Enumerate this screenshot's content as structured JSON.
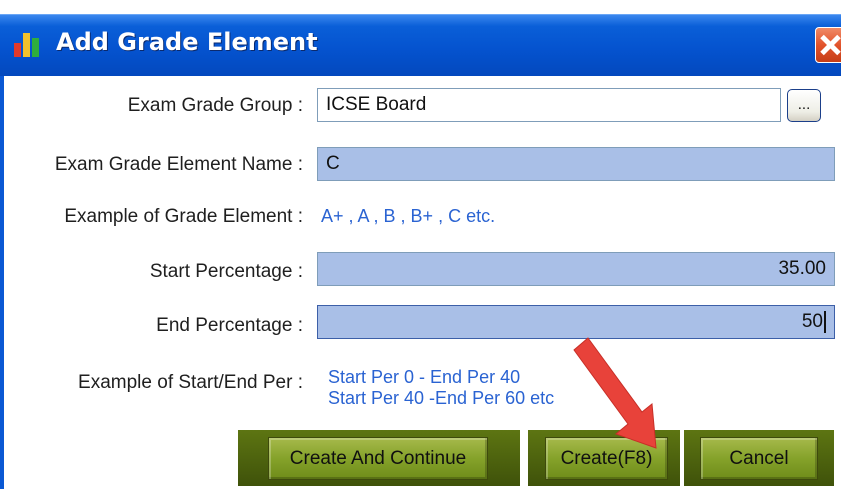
{
  "window": {
    "title": "Add Grade Element"
  },
  "form": {
    "exam_grade_group": {
      "label": "Exam Grade Group :",
      "value": "ICSE Board",
      "browse_label": "..."
    },
    "element_name": {
      "label": "Exam Grade Element Name :",
      "value": "C"
    },
    "grade_example": {
      "label": "Example of Grade Element :",
      "text": "A+ , A , B , B+ , C etc."
    },
    "start_percentage": {
      "label": "Start Percentage :",
      "value": "35.00"
    },
    "end_percentage": {
      "label": "End Percentage :",
      "value": "50"
    },
    "range_example": {
      "label": "Example of Start/End Per :",
      "line1": "Start Per 0 - End Per 40",
      "line2": "Start Per 40 -End Per  60  etc"
    }
  },
  "buttons": {
    "create_continue": "Create And Continue",
    "create": "Create(F8)",
    "cancel": "Cancel"
  },
  "colors": {
    "titlebar": "#0553cf",
    "field_highlight": "#a9bfe7",
    "example_text": "#2a63d2",
    "button_green": "#85a22a",
    "annotation_arrow": "#e8423a"
  }
}
